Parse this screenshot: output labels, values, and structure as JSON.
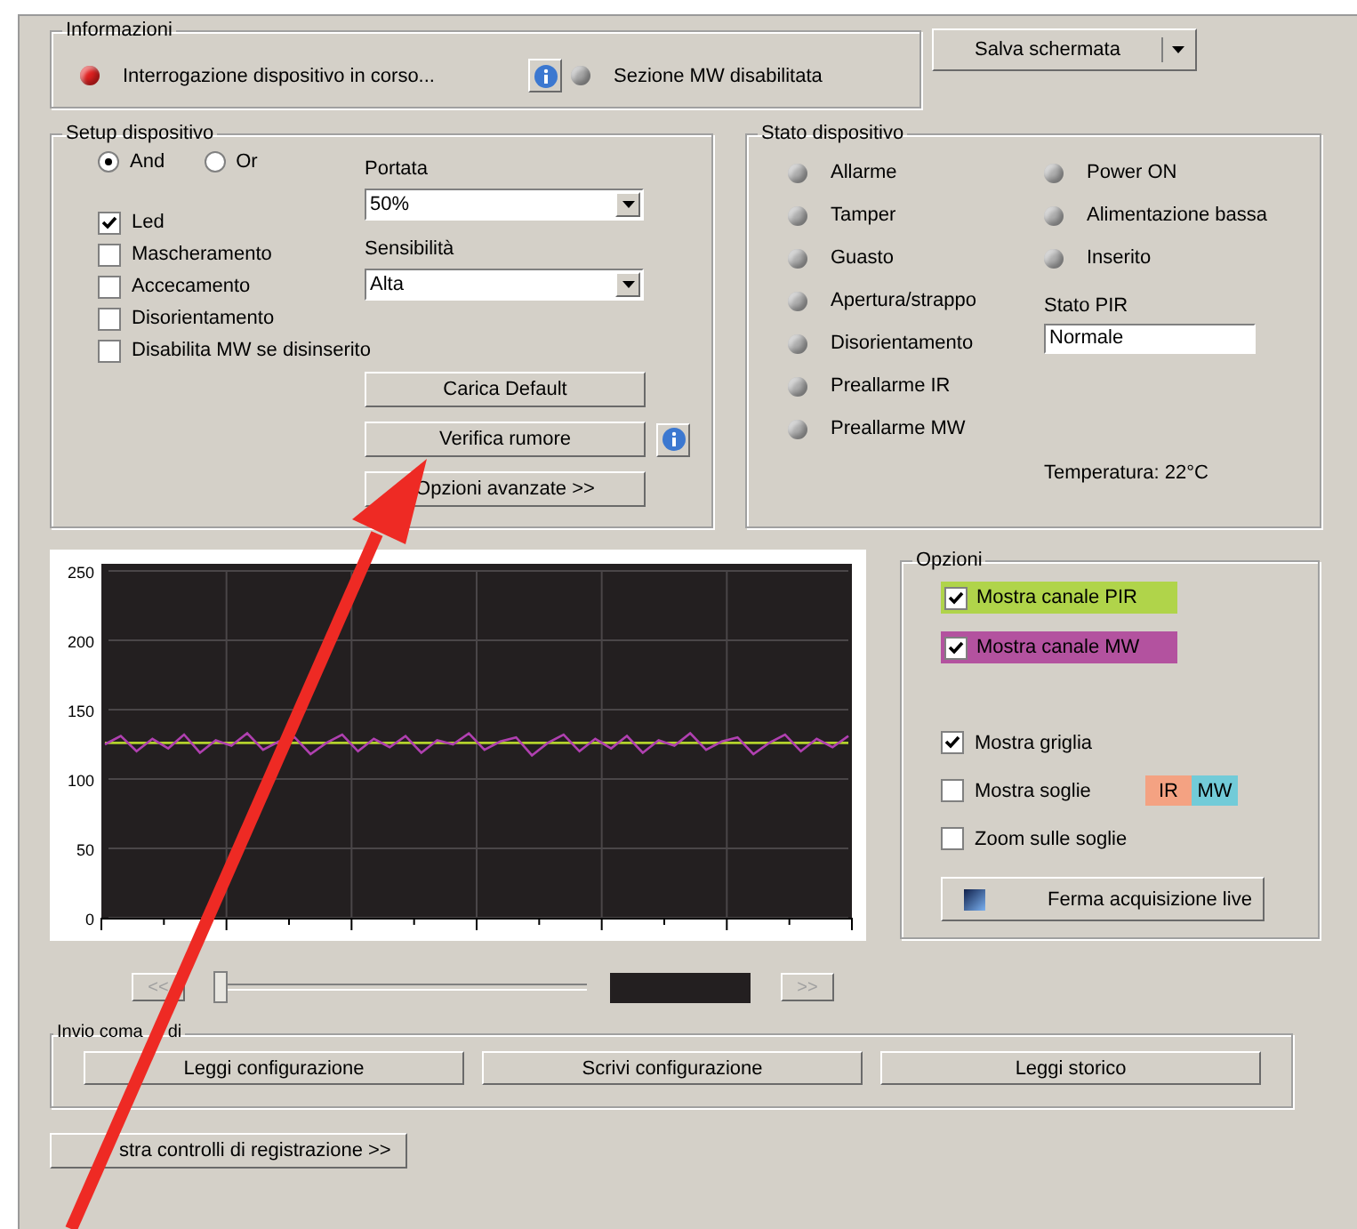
{
  "informazioni": {
    "title": "Informazioni",
    "items": [
      {
        "kind": "led",
        "color": "#e02020",
        "label": "Interrogazione dispositivo in corso..."
      },
      {
        "kind": "info"
      },
      {
        "kind": "led",
        "color": "#a8a8a8",
        "label": "Sezione MW disabilitata"
      }
    ]
  },
  "save_button": {
    "label": "Salva schermata"
  },
  "setup": {
    "title": "Setup dispositivo",
    "logic": [
      {
        "label": "And",
        "selected": true
      },
      {
        "label": "Or",
        "selected": false
      }
    ],
    "checks": [
      {
        "label": "Led",
        "checked": true
      },
      {
        "label": "Mascheramento",
        "checked": false
      },
      {
        "label": "Accecamento",
        "checked": false
      },
      {
        "label": "Disorientamento",
        "checked": false
      },
      {
        "label": "Disabilita MW se disinserito",
        "checked": false
      }
    ],
    "selects": [
      {
        "label": "Portata",
        "value": "50%"
      },
      {
        "label": "Sensibilità",
        "value": "Alta"
      }
    ],
    "buttons": [
      {
        "label": "Carica Default",
        "info": false
      },
      {
        "label": "Verifica rumore",
        "info": true
      },
      {
        "label": "Opzioni avanzate >>",
        "info": false
      }
    ]
  },
  "stato": {
    "title": "Stato dispositivo",
    "left": [
      {
        "label": "Allarme",
        "on": false
      },
      {
        "label": "Tamper",
        "on": false
      },
      {
        "label": "Guasto",
        "on": false
      },
      {
        "label": "Apertura/strappo",
        "on": false
      },
      {
        "label": "Disorientamento",
        "on": false
      },
      {
        "label": "Preallarme IR",
        "on": false
      },
      {
        "label": "Preallarme MW",
        "on": false
      }
    ],
    "right": [
      {
        "label": "Power ON",
        "on": false
      },
      {
        "label": "Alimentazione bassa",
        "on": false
      },
      {
        "label": "Inserito",
        "on": false
      }
    ],
    "pir": {
      "label": "Stato PIR",
      "value": "Normale"
    },
    "temperature": "Temperatura: 22°C"
  },
  "chart": {
    "chart_data": {
      "type": "line",
      "grid": true,
      "ylim": [
        0,
        250
      ],
      "yticks": [
        0,
        50,
        100,
        150,
        200,
        250
      ],
      "series": [
        {
          "color": "#b4d22c",
          "values": [
            126,
            126,
            126,
            126,
            126,
            126,
            126,
            126,
            126,
            126,
            126,
            126,
            126,
            126,
            126,
            126,
            126,
            126,
            126,
            126,
            126,
            126,
            126,
            126,
            126,
            126,
            126,
            126,
            126,
            126,
            126,
            126,
            126,
            126,
            126,
            126,
            126,
            126,
            126,
            126,
            126,
            126,
            126,
            126,
            126,
            126,
            126,
            126
          ]
        },
        {
          "color": "#b040b0",
          "values": [
            125,
            131,
            120,
            129,
            122,
            132,
            119,
            128,
            124,
            133,
            121,
            127,
            130,
            118,
            126,
            132,
            120,
            129,
            123,
            131,
            119,
            128,
            125,
            133,
            121,
            127,
            130,
            117,
            126,
            132,
            120,
            129,
            122,
            131,
            119,
            128,
            124,
            133,
            121,
            127,
            130,
            118,
            126,
            132,
            120,
            129,
            123,
            131
          ]
        }
      ]
    }
  },
  "opzioni": {
    "title": "Opzioni",
    "channels": [
      {
        "label": "Mostra canale PIR",
        "checked": true,
        "color": "#b0d44a"
      },
      {
        "label": "Mostra canale MW",
        "checked": true,
        "color": "#b3529f"
      }
    ],
    "checks": [
      {
        "kind": "plain",
        "label": "Mostra griglia",
        "checked": true
      },
      {
        "kind": "thresholds",
        "label": "Mostra soglie",
        "checked": false,
        "tags": [
          {
            "label": "IR",
            "color": "#f4a282"
          },
          {
            "label": "MW",
            "color": "#72cbd8"
          }
        ]
      },
      {
        "kind": "plain",
        "label": "Zoom sulle soglie",
        "checked": false
      }
    ],
    "button": "Ferma acquisizione live"
  },
  "playback": {
    "prev": "<<",
    "next": ">>",
    "disabled": true,
    "level": 0
  },
  "invio": {
    "title_parts": [
      "Invio coma",
      "di"
    ],
    "buttons": [
      "Leggi configurazione",
      "Scrivi configurazione",
      "Leggi storico"
    ]
  },
  "recording_button": "stra controlli di registrazione >>"
}
